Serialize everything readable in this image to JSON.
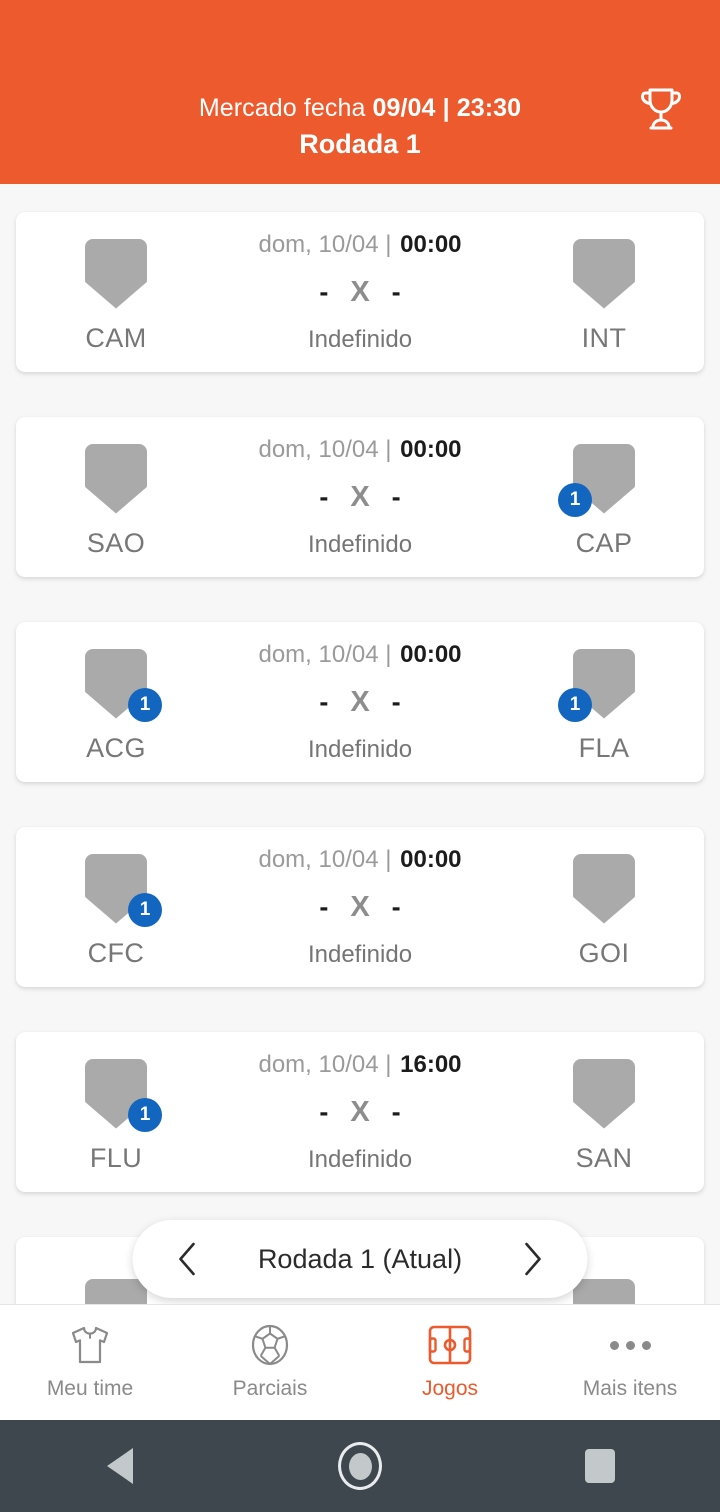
{
  "header": {
    "market_label": "Mercado fecha",
    "market_deadline": "09/04 | 23:30",
    "round_title": "Rodada 1",
    "trophy_icon": "trophy-icon",
    "background_color": "#EC5A2D"
  },
  "matches": [
    {
      "home": {
        "abbr": "CAM",
        "badge": "",
        "badge_visible": false
      },
      "away": {
        "abbr": "INT",
        "badge": "",
        "badge_visible": false
      },
      "date": "dom, 10/04 | ",
      "time": "00:00",
      "home_goals": "-",
      "versus": "X",
      "away_goals": "-",
      "status": "Indefinido"
    },
    {
      "home": {
        "abbr": "SAO",
        "badge": "",
        "badge_visible": false
      },
      "away": {
        "abbr": "CAP",
        "badge": "1",
        "badge_visible": true
      },
      "date": "dom, 10/04 | ",
      "time": "00:00",
      "home_goals": "-",
      "versus": "X",
      "away_goals": "-",
      "status": "Indefinido"
    },
    {
      "home": {
        "abbr": "ACG",
        "badge": "1",
        "badge_visible": true
      },
      "away": {
        "abbr": "FLA",
        "badge": "1",
        "badge_visible": true
      },
      "date": "dom, 10/04 | ",
      "time": "00:00",
      "home_goals": "-",
      "versus": "X",
      "away_goals": "-",
      "status": "Indefinido"
    },
    {
      "home": {
        "abbr": "CFC",
        "badge": "1",
        "badge_visible": true
      },
      "away": {
        "abbr": "GOI",
        "badge": "",
        "badge_visible": false
      },
      "date": "dom, 10/04 | ",
      "time": "00:00",
      "home_goals": "-",
      "versus": "X",
      "away_goals": "-",
      "status": "Indefinido"
    },
    {
      "home": {
        "abbr": "FLU",
        "badge": "1",
        "badge_visible": true
      },
      "away": {
        "abbr": "SAN",
        "badge": "",
        "badge_visible": false
      },
      "date": "dom, 10/04 | ",
      "time": "16:00",
      "home_goals": "-",
      "versus": "X",
      "away_goals": "-",
      "status": "Indefinido"
    },
    {
      "home": {
        "abbr": "",
        "badge": "",
        "badge_visible": false
      },
      "away": {
        "abbr": "",
        "badge": "",
        "badge_visible": false
      },
      "date": "",
      "time": "",
      "home_goals": "",
      "versus": "",
      "away_goals": "",
      "status": ""
    }
  ],
  "round_selector": {
    "prev_icon": "chevron-left-icon",
    "label": "Rodada 1 (Atual)",
    "next_icon": "chevron-right-icon"
  },
  "tab_bar": {
    "active_color": "#EC5A2D",
    "inactive_color": "#8A8A8A",
    "items": [
      {
        "label": "Meu time",
        "icon": "shirt-icon",
        "active": false
      },
      {
        "label": "Parciais",
        "icon": "soccer-ball-icon",
        "active": false
      },
      {
        "label": "Jogos",
        "icon": "pitch-icon",
        "active": true
      },
      {
        "label": "Mais itens",
        "icon": "ellipsis-icon",
        "active": false
      }
    ]
  },
  "system_nav": {
    "back": "back-triangle-icon",
    "home": "home-circle-icon",
    "recents": "recents-square-icon",
    "background_color": "#3F474E"
  }
}
